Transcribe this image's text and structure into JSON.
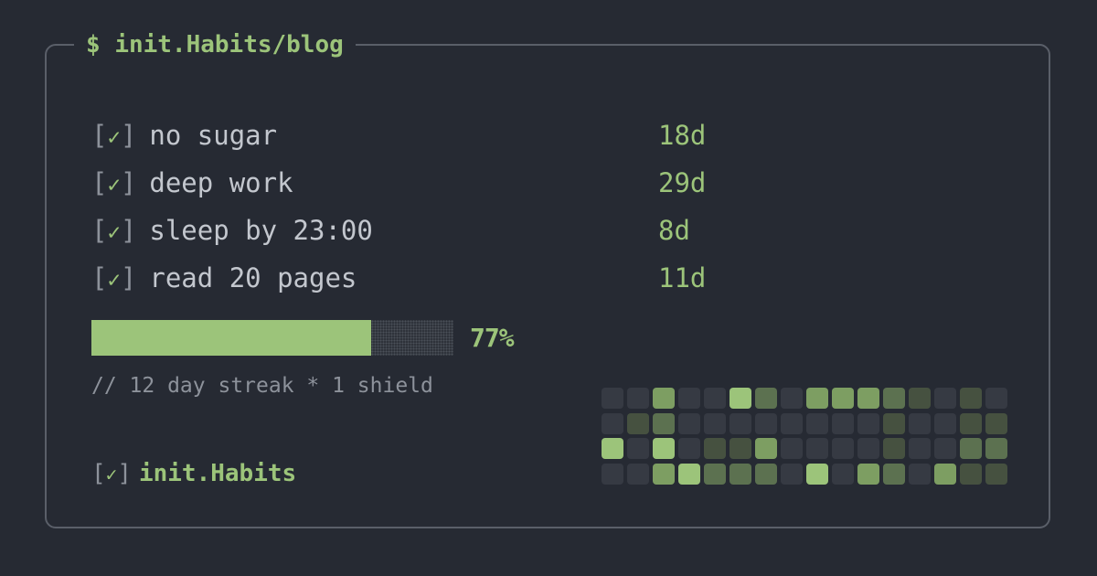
{
  "header": {
    "prompt": "$",
    "title": "init.Habits/blog"
  },
  "habits": [
    {
      "name": "no sugar",
      "streak": "18d",
      "checked": true
    },
    {
      "name": "deep work",
      "streak": "29d",
      "checked": true
    },
    {
      "name": "sleep by 23:00",
      "streak": "8d",
      "checked": true
    },
    {
      "name": "read 20 pages",
      "streak": "11d",
      "checked": true
    }
  ],
  "checkbox": {
    "open": "[",
    "mark": "✓",
    "close": "]"
  },
  "progress": {
    "value": 0.77,
    "label": "77%"
  },
  "summary": "// 12 day streak * 1 shield",
  "footer": {
    "name": "init.Habits"
  },
  "heatmap": {
    "rows": [
      [
        0,
        0,
        3,
        0,
        0,
        4,
        2,
        0,
        3,
        3,
        3,
        2,
        1,
        0,
        1,
        0
      ],
      [
        0,
        1,
        2,
        0,
        0,
        0,
        0,
        0,
        0,
        0,
        0,
        1,
        0,
        0,
        1,
        1
      ],
      [
        4,
        0,
        4,
        0,
        1,
        1,
        3,
        0,
        0,
        0,
        0,
        1,
        0,
        0,
        2,
        2
      ],
      [
        0,
        0,
        3,
        4,
        2,
        2,
        2,
        0,
        4,
        0,
        3,
        2,
        0,
        3,
        1,
        1
      ]
    ]
  },
  "colors": {
    "background": "#262a33",
    "border": "#5a5f69",
    "accent": "#9cc47a",
    "text": "#c3c7ce",
    "muted": "#8d929b",
    "heat_levels": [
      "#363a43",
      "#465140",
      "#5c7150",
      "#7d9e62",
      "#9cc47a"
    ]
  }
}
